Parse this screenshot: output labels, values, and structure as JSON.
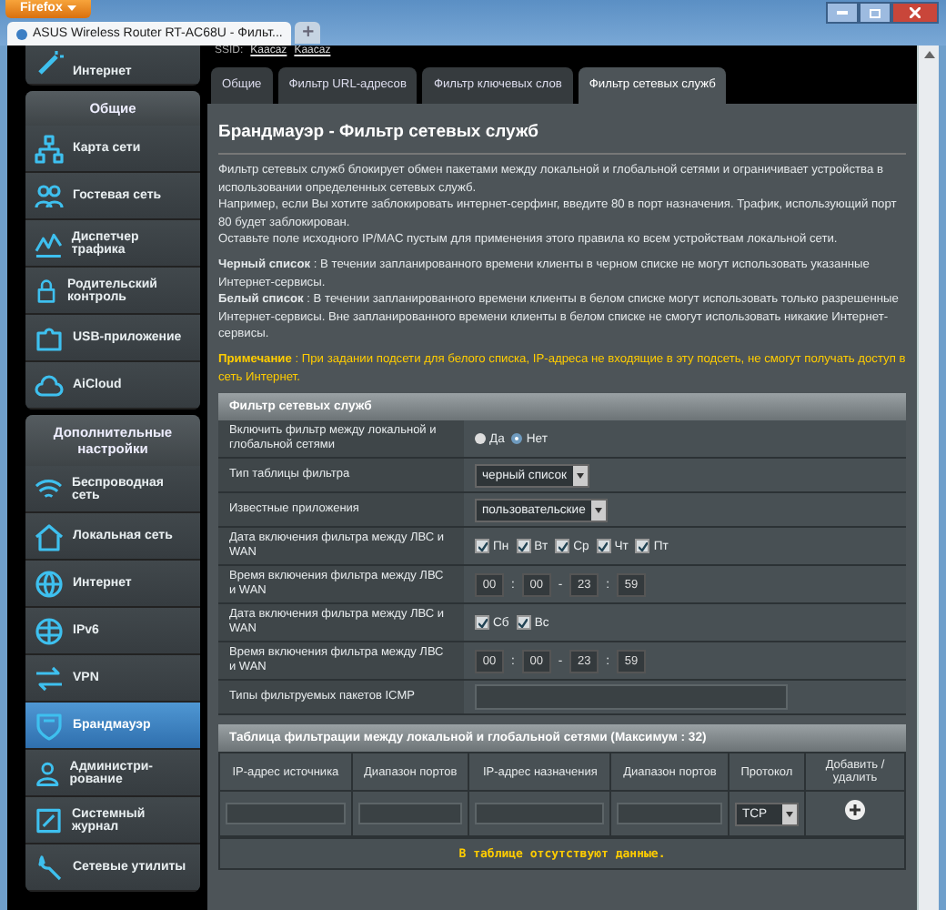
{
  "browser": {
    "menu_button": "Firefox",
    "tabs": [
      {
        "label": "ASUS Wireless Router RT-AC68U - Фильт...",
        "selected": true
      }
    ],
    "new_tab": "+"
  },
  "ssid": {
    "label": "SSID:",
    "values": [
      "Kaacaz",
      "Kaacaz"
    ]
  },
  "sidebar": {
    "partial_item": {
      "label": "Интернет"
    },
    "sections": [
      {
        "title": "Общие",
        "items": [
          {
            "label": "Карта сети",
            "selected": false
          },
          {
            "label": "Гостевая сеть",
            "selected": false
          },
          {
            "label": "Диспетчер трафика",
            "selected": false
          },
          {
            "label": "Родительский контроль",
            "selected": false
          },
          {
            "label": "USB-приложение",
            "selected": false
          },
          {
            "label": "AiCloud",
            "selected": false
          }
        ]
      },
      {
        "title": "Дополнительные настройки",
        "items": [
          {
            "label": "Беспроводная сеть",
            "selected": false
          },
          {
            "label": "Локальная сеть",
            "selected": false
          },
          {
            "label": "Интернет",
            "selected": false
          },
          {
            "label": "IPv6",
            "selected": false
          },
          {
            "label": "VPN",
            "selected": false
          },
          {
            "label": "Брандмауэр",
            "selected": true
          },
          {
            "label": "Администри-рование",
            "selected": false
          },
          {
            "label": "Системный журнал",
            "selected": false
          },
          {
            "label": "Сетевые утилиты",
            "selected": false
          }
        ]
      }
    ]
  },
  "tabs": [
    {
      "label": "Общие",
      "selected": false
    },
    {
      "label": "Фильтр URL-адресов",
      "selected": false
    },
    {
      "label": "Фильтр ключевых слов",
      "selected": false
    },
    {
      "label": "Фильтр сетевых служб",
      "selected": true
    }
  ],
  "page_title": "Брандмауэр - Фильтр сетевых служб",
  "description": [
    [
      "Фильтр сетевых служб блокирует обмен пакетами между локальной и глобальной сетями и ограничивает устройства в использовании определенных сетевых служб.",
      "Например, если Вы хотите заблокировать интернет-серфинг, введите 80 в порт назначения. Трафик, использующий порт 80 будет заблокирован.",
      "Оставьте поле исходного IP/MAC пустым для применения этого правила ко всем устройствам локальной сети."
    ],
    [
      "**Черный список** : В течении запланированного времени клиенты в черном списке не могут использовать указанные Интернет-сервисы.",
      "**Белый список** : В течении запланированного времени клиенты в белом списке могут использовать только разрешенные Интернет-сервисы. Вне запланированного времени клиенты в белом списке не смогут использовать никакие Интернет-сервисы."
    ]
  ],
  "note": "**Примечание** : При задании подсети для белого списка, IP-адреса не входящие в эту подсеть, не смогут получать доступ в сеть Интернет.",
  "filter_section": {
    "title": "Фильтр сетевых служб",
    "rows": [
      {
        "kind": "radio",
        "label": "Включить фильтр между локальной и глобальной сетями",
        "options": [
          {
            "label": "Да",
            "selected": false
          },
          {
            "label": "Нет",
            "selected": true
          }
        ]
      },
      {
        "kind": "select",
        "label": "Тип таблицы фильтра",
        "value": "черный список"
      },
      {
        "kind": "select",
        "label": "Известные приложения",
        "value": "пользовательские"
      },
      {
        "kind": "days",
        "label": "Дата включения фильтра между ЛВС и WAN",
        "days": [
          {
            "label": "Пн",
            "checked": true
          },
          {
            "label": "Вт",
            "checked": true
          },
          {
            "label": "Ср",
            "checked": true
          },
          {
            "label": "Чт",
            "checked": true
          },
          {
            "label": "Пт",
            "checked": true
          }
        ]
      },
      {
        "kind": "time",
        "label": "Время включения фильтра между ЛВС и WAN",
        "values": [
          "00",
          "00",
          "23",
          "59"
        ],
        "separators": [
          ":",
          "-",
          ":"
        ]
      },
      {
        "kind": "days",
        "label": "Дата включения фильтра между ЛВС и WAN",
        "days": [
          {
            "label": "Сб",
            "checked": true
          },
          {
            "label": "Вс",
            "checked": true
          }
        ]
      },
      {
        "kind": "time",
        "label": "Время включения фильтра между ЛВС и WAN",
        "values": [
          "00",
          "00",
          "23",
          "59"
        ],
        "separators": [
          ":",
          "-",
          ":"
        ]
      },
      {
        "kind": "text",
        "label": "Типы фильтруемых пакетов ICMP"
      }
    ]
  },
  "rule_table": {
    "title": "Таблица фильтрации между локальной и глобальной сетями (Максимум : 32)",
    "columns": [
      "IP-адрес источника",
      "Диапазон портов",
      "IP-адрес назначения",
      "Диапазон портов",
      "Протокол",
      "Добавить / удалить"
    ],
    "protocol": "TCP",
    "empty_message": "В таблице отсутствуют данные."
  }
}
